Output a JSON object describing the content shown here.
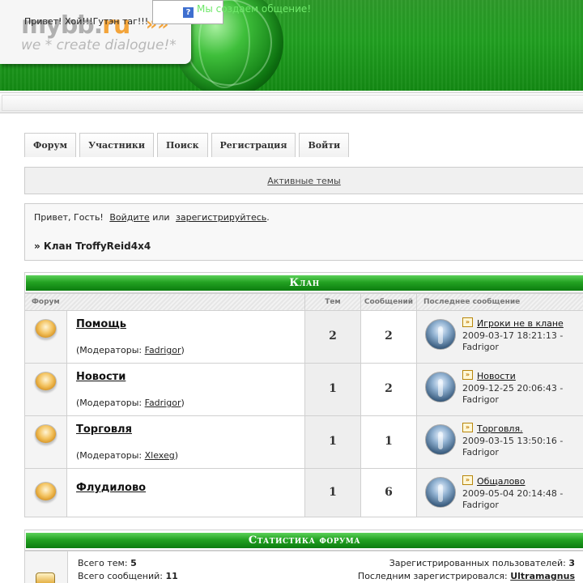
{
  "header": {
    "logo_main": "mybb.",
    "logo_accent": "ru",
    "logo_arrows": "»»",
    "logo_tagline": "we * create dialogue!*",
    "greeting": "Привет! Хой!!!Гутэн таг!!!",
    "help_icon": "?",
    "slogan": "Мы создаем общение!"
  },
  "nav": [
    {
      "label": "Форум"
    },
    {
      "label": "Участники"
    },
    {
      "label": "Поиск"
    },
    {
      "label": "Регистрация"
    },
    {
      "label": "Войти"
    }
  ],
  "active_topics": "Активные темы",
  "welcome": {
    "greeting": "Привет, Гость!",
    "login": "Войдите",
    "or": "или",
    "register": "зарегистрируйтесь",
    "period": ".",
    "breadcrumb": "» Клан TroffyReid4x4"
  },
  "category": {
    "title": "Клан",
    "columns": {
      "forum": "Форум",
      "topics": "Тем",
      "posts": "Сообщений",
      "last": "Последнее сообщение"
    }
  },
  "forums": [
    {
      "name": "Помощь",
      "mods_prefix": "(Модераторы: ",
      "mod": "Fadrigor",
      "mods_suffix": ")",
      "topics": "2",
      "posts": "2",
      "last_title": "Игроки не в клане",
      "last_date": "2009-03-17 18:21:13 -",
      "last_author": "Fadrigor"
    },
    {
      "name": "Новости",
      "mods_prefix": "(Модераторы: ",
      "mod": "Fadrigor",
      "mods_suffix": ")",
      "topics": "1",
      "posts": "2",
      "last_title": "Новости",
      "last_date": "2009-12-25 20:06:43 -",
      "last_author": "Fadrigor"
    },
    {
      "name": "Торговля",
      "mods_prefix": "(Модераторы: ",
      "mod": "Xlexeg",
      "mods_suffix": ")",
      "topics": "1",
      "posts": "1",
      "last_title": "Торговля.",
      "last_date": "2009-03-15 13:50:16 -",
      "last_author": "Fadrigor"
    },
    {
      "name": "Флудилово",
      "mods_prefix": "",
      "mod": "",
      "mods_suffix": "",
      "topics": "1",
      "posts": "6",
      "last_title": "Общалово",
      "last_date": "2009-05-04 20:14:48 -",
      "last_author": "Fadrigor"
    }
  ],
  "stats": {
    "title": "Статистика форума",
    "topics_label": "Всего тем:",
    "topics_value": "5",
    "posts_label": "Всего сообщений:",
    "posts_value": "11",
    "users_label": "Зарегистрированных пользователей:",
    "users_value": "3",
    "last_user_label": "Последним зарегистрировался:",
    "last_user_value": "Ultramagnus"
  }
}
